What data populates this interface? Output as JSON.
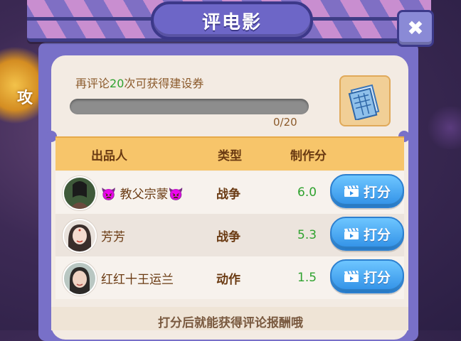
{
  "dialog": {
    "title": "评电影",
    "close_icon": "close-x-icon"
  },
  "background": {
    "left_text": "攻"
  },
  "quest": {
    "prefix": "再评论",
    "count": "20",
    "suffix": "次可获得建设券",
    "progress_current": 0,
    "progress_total": 20,
    "progress_label": "0/20",
    "reward_icon": "construction-voucher-icon"
  },
  "table": {
    "headers": {
      "producer": "出品人",
      "genre": "类型",
      "score": "制作分"
    },
    "rows": [
      {
        "name": "👿 教父宗蒙👿",
        "genre": "战争",
        "score": "6.0",
        "button_label": "打分"
      },
      {
        "name": "芳芳",
        "genre": "战争",
        "score": "5.3",
        "button_label": "打分"
      },
      {
        "name": "红红十王运兰",
        "genre": "动作",
        "score": "1.5",
        "button_label": "打分"
      }
    ]
  },
  "footer": {
    "text": "打分后就能获得评论报酬哦"
  },
  "colors": {
    "accent_green": "#2fa22f",
    "button_blue": "#2f8fe6",
    "header_orange": "#f7c56a",
    "panel_purple": "#7870c8"
  }
}
